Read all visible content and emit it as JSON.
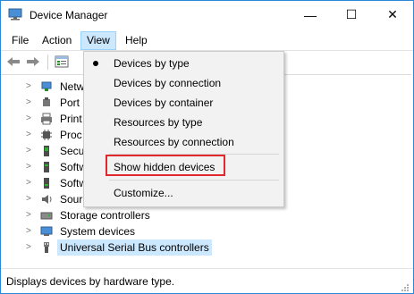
{
  "window": {
    "title": "Device Manager",
    "controls": {
      "minimize": "—",
      "maximize": "☐",
      "close": "✕"
    }
  },
  "menubar": {
    "items": [
      "File",
      "Action",
      "View",
      "Help"
    ],
    "active": "View"
  },
  "tree": {
    "rows": [
      {
        "label": "Netw",
        "icon": "network-adapter-icon"
      },
      {
        "label": "Port",
        "icon": "port-icon"
      },
      {
        "label": "Print",
        "icon": "printer-icon"
      },
      {
        "label": "Proc",
        "icon": "processor-icon"
      },
      {
        "label": "Secu",
        "icon": "security-device-icon"
      },
      {
        "label": "Softw",
        "icon": "software-component-icon"
      },
      {
        "label": "Softw",
        "icon": "software-device-icon"
      },
      {
        "label": "Sour",
        "icon": "sound-icon"
      },
      {
        "label": "Storage controllers",
        "icon": "storage-controller-icon"
      },
      {
        "label": "System devices",
        "icon": "system-devices-icon"
      },
      {
        "label": "Universal Serial Bus controllers",
        "icon": "usb-icon",
        "selected": true
      }
    ]
  },
  "view_menu": {
    "items": [
      {
        "label": "Devices by type",
        "checked": true
      },
      {
        "label": "Devices by connection",
        "checked": false
      },
      {
        "label": "Devices by container",
        "checked": false
      },
      {
        "label": "Resources by type",
        "checked": false
      },
      {
        "label": "Resources by connection",
        "checked": false
      },
      {
        "label": "Show hidden devices",
        "checked": false,
        "highlighted": true
      },
      {
        "label": "Customize...",
        "checked": false
      }
    ]
  },
  "status": {
    "text": "Displays devices by hardware type."
  },
  "colors": {
    "accent_border": "#2b88d8",
    "menu_active": "#cce8ff",
    "highlight_box": "#e0282e"
  }
}
